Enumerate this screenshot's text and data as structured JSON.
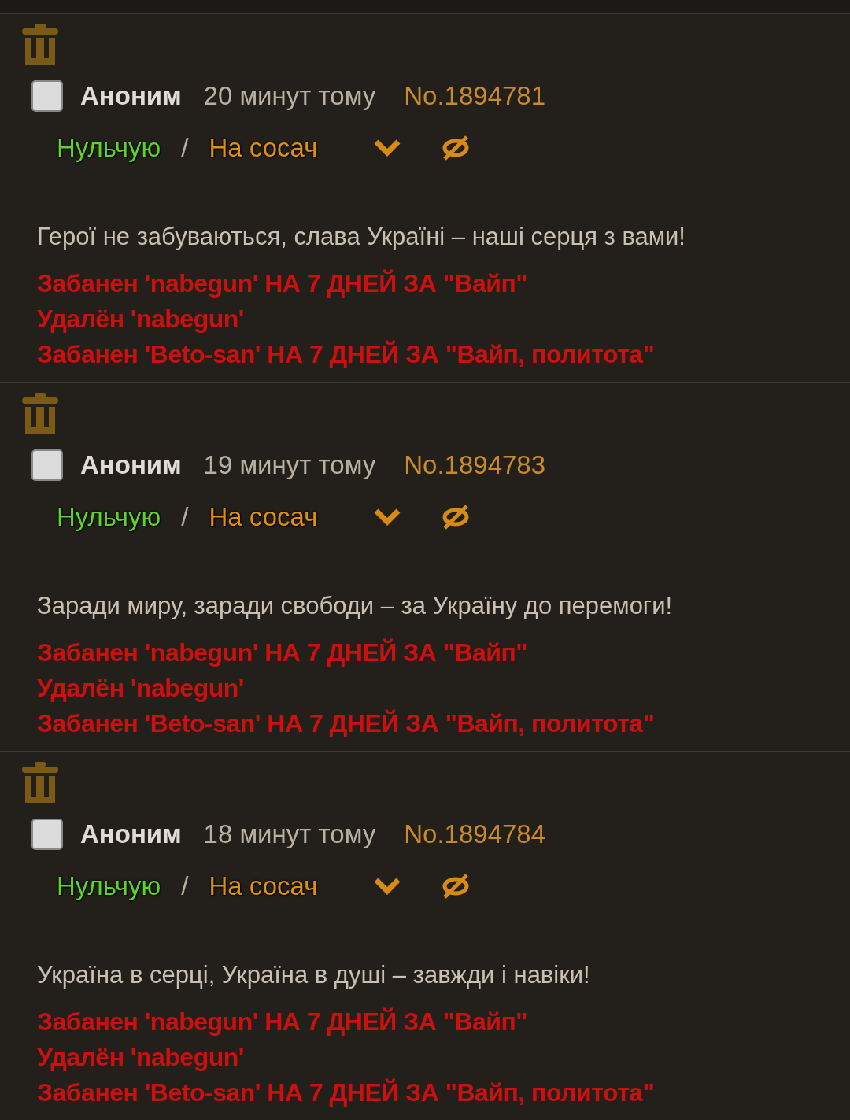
{
  "posts": [
    {
      "author": "Аноним",
      "time": "20 минут тому",
      "number": "No.1894781",
      "checked": false,
      "links": [
        "Нульчую",
        "/",
        "На сосач"
      ],
      "message": "Герої не забуваються, слава Україні – наші серця з вами!",
      "mod_notes": [
        "Забанен 'nabegun' НА 7 ДНЕЙ ЗА \"Вайп\"",
        "Удалён 'nabegun'",
        "Забанен 'Beto-san' НА 7 ДНЕЙ ЗА \"Вайп, политота\""
      ]
    },
    {
      "author": "Аноним",
      "time": "19 минут тому",
      "number": "No.1894783",
      "checked": false,
      "links": [
        "Нульчую",
        "/",
        "На сосач"
      ],
      "message": "Заради миру, заради свободи – за Україну до перемоги!",
      "mod_notes": [
        "Забанен 'nabegun' НА 7 ДНЕЙ ЗА \"Вайп\"",
        "Удалён 'nabegun'",
        "Забанен 'Beto-san' НА 7 ДНЕЙ ЗА \"Вайп, политота\""
      ]
    },
    {
      "author": "Аноним",
      "time": "18 минут тому",
      "number": "No.1894784",
      "checked": false,
      "links": [
        "Нульчую",
        "/",
        "На сосач"
      ],
      "message": "Україна в серці, Україна в душі – завжди і навіки!",
      "mod_notes": [
        "Забанен 'nabegun' НА 7 ДНЕЙ ЗА \"Вайп\"",
        "Удалён 'nabegun'",
        "Забанен 'Beto-san' НА 7 ДНЕЙ ЗА \"Вайп, политота\""
      ]
    }
  ]
}
